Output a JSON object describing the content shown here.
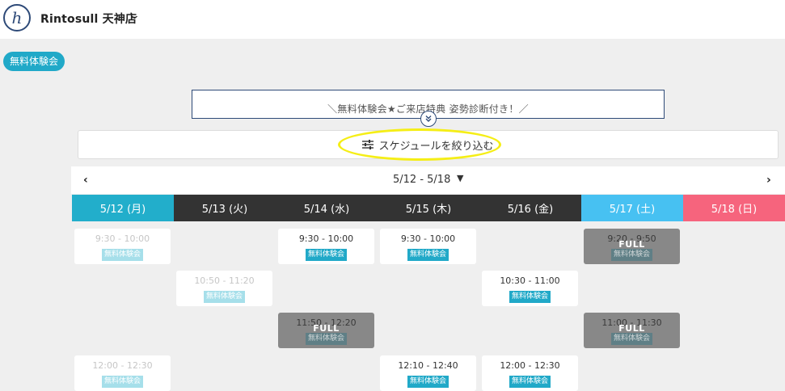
{
  "header": {
    "logo_glyph": "h",
    "store_name": "Rintosull 天神店",
    "store_chevron": "⌄"
  },
  "tag": {
    "label": "無料体験会"
  },
  "banner": {
    "text": "＼無料体験会★ご来店特典 姿勢診断付き！／",
    "expand_icon": "double-chevron-down-icon"
  },
  "filter": {
    "label": "スケジュールを絞り込む",
    "icon": "sliders-icon"
  },
  "week_nav": {
    "prev": "‹",
    "next": "›",
    "label": "5/12 - 5/18",
    "caret": "▼"
  },
  "colors": {
    "mon": "#22aecb",
    "tue": "#333333",
    "wed": "#333333",
    "thu": "#333333",
    "fri": "#333333",
    "sat": "#47c1f2",
    "sun": "#f6647d"
  },
  "days": [
    {
      "label": "5/12 (月)",
      "color": "#22aecb"
    },
    {
      "label": "5/13 (火)",
      "color": "#333333"
    },
    {
      "label": "5/14 (水)",
      "color": "#333333"
    },
    {
      "label": "5/15 (木)",
      "color": "#333333"
    },
    {
      "label": "5/16 (金)",
      "color": "#333333"
    },
    {
      "label": "5/17 (土)",
      "color": "#47c1f2"
    },
    {
      "label": "5/18 (日)",
      "color": "#f6647d"
    }
  ],
  "slots": [
    {
      "time": "9:30 - 10:00",
      "label": "無料体験会",
      "status": "past"
    },
    {
      "time": "10:50 - 11:20",
      "label": "無料体験会",
      "status": "past"
    },
    {
      "time": "12:00 - 12:30",
      "label": "無料体験会",
      "status": "past"
    },
    {
      "time": "9:30 - 10:00",
      "label": "無料体験会",
      "status": "open"
    },
    {
      "time": "11:50 - 12:20",
      "label": "無料体験会",
      "status": "full",
      "full_text": "FULL"
    },
    {
      "time": "9:30 - 10:00",
      "label": "無料体験会",
      "status": "open"
    },
    {
      "time": "12:10 - 12:40",
      "label": "無料体験会",
      "status": "open"
    },
    {
      "time": "10:30 - 11:00",
      "label": "無料体験会",
      "status": "open"
    },
    {
      "time": "12:00 - 12:30",
      "label": "無料体験会",
      "status": "open"
    },
    {
      "time": "9:20 - 9:50",
      "label": "無料体験会",
      "status": "full",
      "full_text": "FULL"
    },
    {
      "time": "11:00 - 11:30",
      "label": "無料体験会",
      "status": "full",
      "full_text": "FULL"
    }
  ]
}
